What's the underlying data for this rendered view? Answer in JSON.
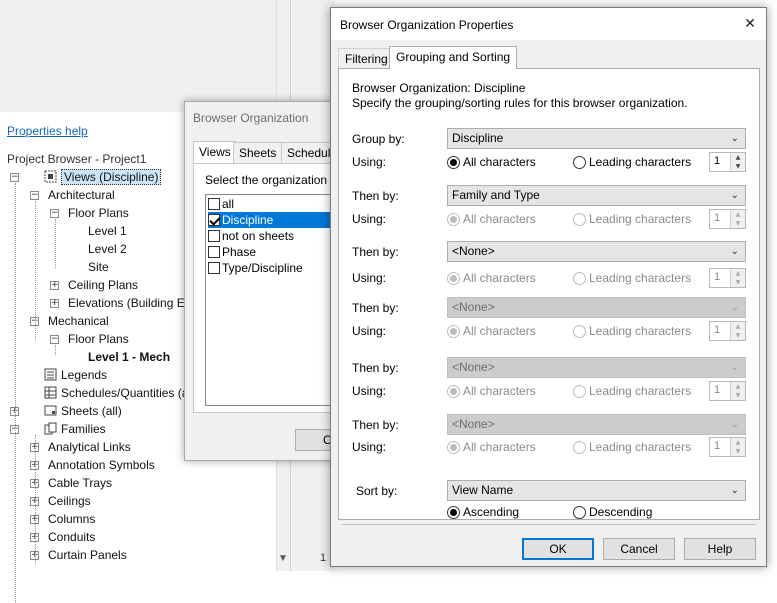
{
  "project_browser": {
    "properties_help": "Properties help",
    "title": "Project Browser - Project1",
    "tree": [
      {
        "label": "Views (Discipline)",
        "expander": "−",
        "icon": "views-icon",
        "selected": true
      },
      {
        "label": "Architectural",
        "expander": "−"
      },
      {
        "label": "Floor Plans",
        "expander": "−"
      },
      {
        "label": "Level 1"
      },
      {
        "label": "Level 2"
      },
      {
        "label": "Site"
      },
      {
        "label": "Ceiling Plans",
        "expander": "+"
      },
      {
        "label": "Elevations (Building E",
        "expander": "+"
      },
      {
        "label": "Mechanical",
        "expander": "−"
      },
      {
        "label": "Floor Plans",
        "expander": "−"
      },
      {
        "label": "Level 1 - Mech",
        "bold": true
      },
      {
        "label": "Legends",
        "icon": "legend-icon"
      },
      {
        "label": "Schedules/Quantities (all)",
        "icon": "schedule-icon"
      },
      {
        "label": "Sheets (all)",
        "expander": "+",
        "icon": "sheet-icon"
      },
      {
        "label": "Families",
        "expander": "−",
        "icon": "family-icon"
      },
      {
        "label": "Analytical Links",
        "expander": "+"
      },
      {
        "label": "Annotation Symbols",
        "expander": "+"
      },
      {
        "label": "Cable Trays",
        "expander": "+"
      },
      {
        "label": "Ceilings",
        "expander": "+"
      },
      {
        "label": "Columns",
        "expander": "+"
      },
      {
        "label": "Conduits",
        "expander": "+"
      },
      {
        "label": "Curtain Panels",
        "expander": "+"
      }
    ],
    "bottom_text": "1 :"
  },
  "browser_org": {
    "title": "Browser Organization",
    "tabs": [
      "Views",
      "Sheets",
      "Schedules"
    ],
    "select_text": "Select the organization sch",
    "items": [
      {
        "label": "all",
        "checked": false
      },
      {
        "label": "Discipline",
        "checked": true
      },
      {
        "label": "not on sheets",
        "checked": false
      },
      {
        "label": "Phase",
        "checked": false
      },
      {
        "label": "Type/Discipline",
        "checked": false
      }
    ],
    "ok_fragment": "O"
  },
  "bop": {
    "title": "Browser Organization Properties",
    "close_glyph": "✕",
    "tabs": {
      "filtering": "Filtering",
      "grouping": "Grouping and Sorting"
    },
    "org_line": "Browser Organization: Discipline",
    "desc_line": "Specify the grouping/sorting rules for this browser organization.",
    "labels": {
      "using": "Using:",
      "all_chars": "All characters",
      "leading_chars": "Leading characters"
    },
    "groups": [
      {
        "label": "Group by:",
        "value": "Discipline",
        "enabled": true,
        "count": "1"
      },
      {
        "label": "Then by:",
        "value": "Family and Type",
        "enabled": true,
        "count": "1"
      },
      {
        "label": "Then by:",
        "value": "<None>",
        "enabled": true,
        "count": "1"
      },
      {
        "label": "Then by:",
        "value": "<None>",
        "enabled": false,
        "count": "1"
      },
      {
        "label": "Then by:",
        "value": "<None>",
        "enabled": false,
        "count": "1"
      },
      {
        "label": "Then by:",
        "value": "<None>",
        "enabled": false,
        "count": "1"
      }
    ],
    "sort": {
      "label": "Sort by:",
      "value": "View Name",
      "ascending": "Ascending",
      "descending": "Descending"
    },
    "buttons": {
      "ok": "OK",
      "cancel": "Cancel",
      "help": "Help"
    }
  }
}
